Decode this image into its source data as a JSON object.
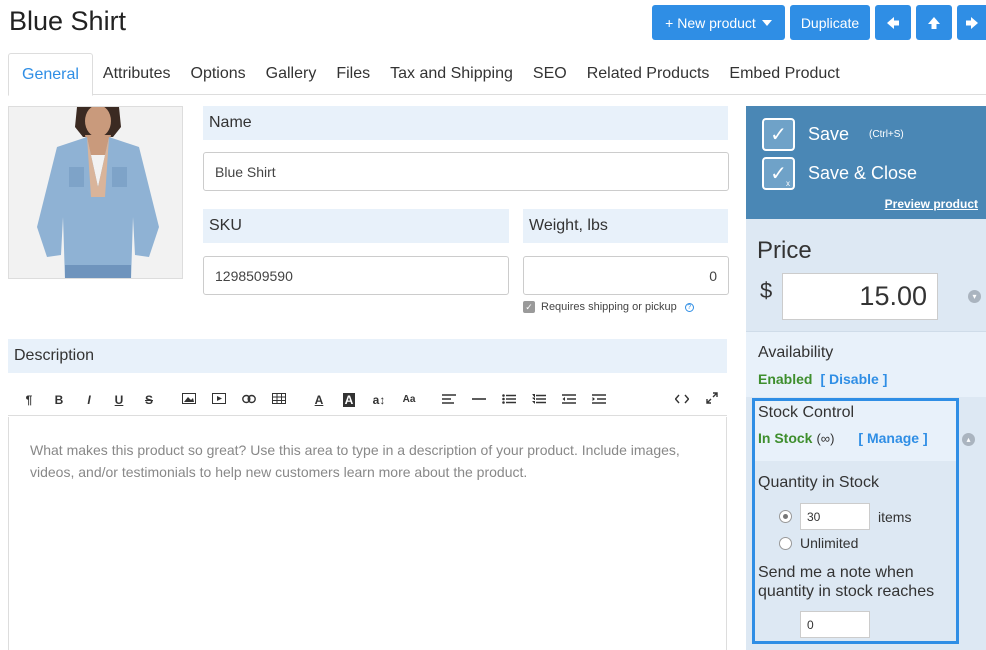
{
  "page": {
    "title": "Blue Shirt"
  },
  "actions": {
    "new_product": "+ New product",
    "duplicate": "Duplicate"
  },
  "tabs": [
    {
      "label": "General",
      "active": true
    },
    {
      "label": "Attributes"
    },
    {
      "label": "Options"
    },
    {
      "label": "Gallery"
    },
    {
      "label": "Files"
    },
    {
      "label": "Tax and Shipping"
    },
    {
      "label": "SEO"
    },
    {
      "label": "Related Products"
    },
    {
      "label": "Embed Product"
    }
  ],
  "form": {
    "name_label": "Name",
    "name_value": "Blue Shirt",
    "sku_label": "SKU",
    "sku_value": "1298509590",
    "weight_label": "Weight, lbs",
    "weight_value": "0",
    "requires_shipping": "Requires shipping or pickup",
    "requires_shipping_checked": true,
    "description_label": "Description",
    "description_placeholder": "What makes this product so great? Use this area to type in a description of your product. Include images, videos, and/or testimonials to help new customers learn more about the product."
  },
  "toolbar": {
    "paragraph": "¶",
    "bold": "B",
    "italic": "I",
    "underline": "U",
    "strike": "S",
    "font_color": "A",
    "bg_color": "A",
    "font_size": "a↕",
    "font_family": "Aa"
  },
  "sidebar": {
    "save": "Save",
    "save_hint": "(Ctrl+S)",
    "save_close": "Save & Close",
    "preview": "Preview product",
    "price_title": "Price",
    "currency": "$",
    "price_value": "15.00",
    "availability_title": "Availability",
    "availability_status": "Enabled",
    "availability_action": "[ Disable ]",
    "stock_title": "Stock Control",
    "stock_status": "In Stock",
    "stock_infinity": "(∞)",
    "stock_action": "[ Manage ]",
    "qty_title": "Quantity in Stock",
    "qty_value": "30",
    "qty_unit": "items",
    "qty_option_unlimited": "Unlimited",
    "qty_selected": "items",
    "note_text": "Send me a note when quantity in stock reaches",
    "note_value": "0"
  },
  "colors": {
    "accent": "#2f8ee5",
    "save_panel": "#4a87b5",
    "side_bg": "#dde8f3",
    "label_bg": "#e8f1fa",
    "green": "#3e8e2d"
  }
}
